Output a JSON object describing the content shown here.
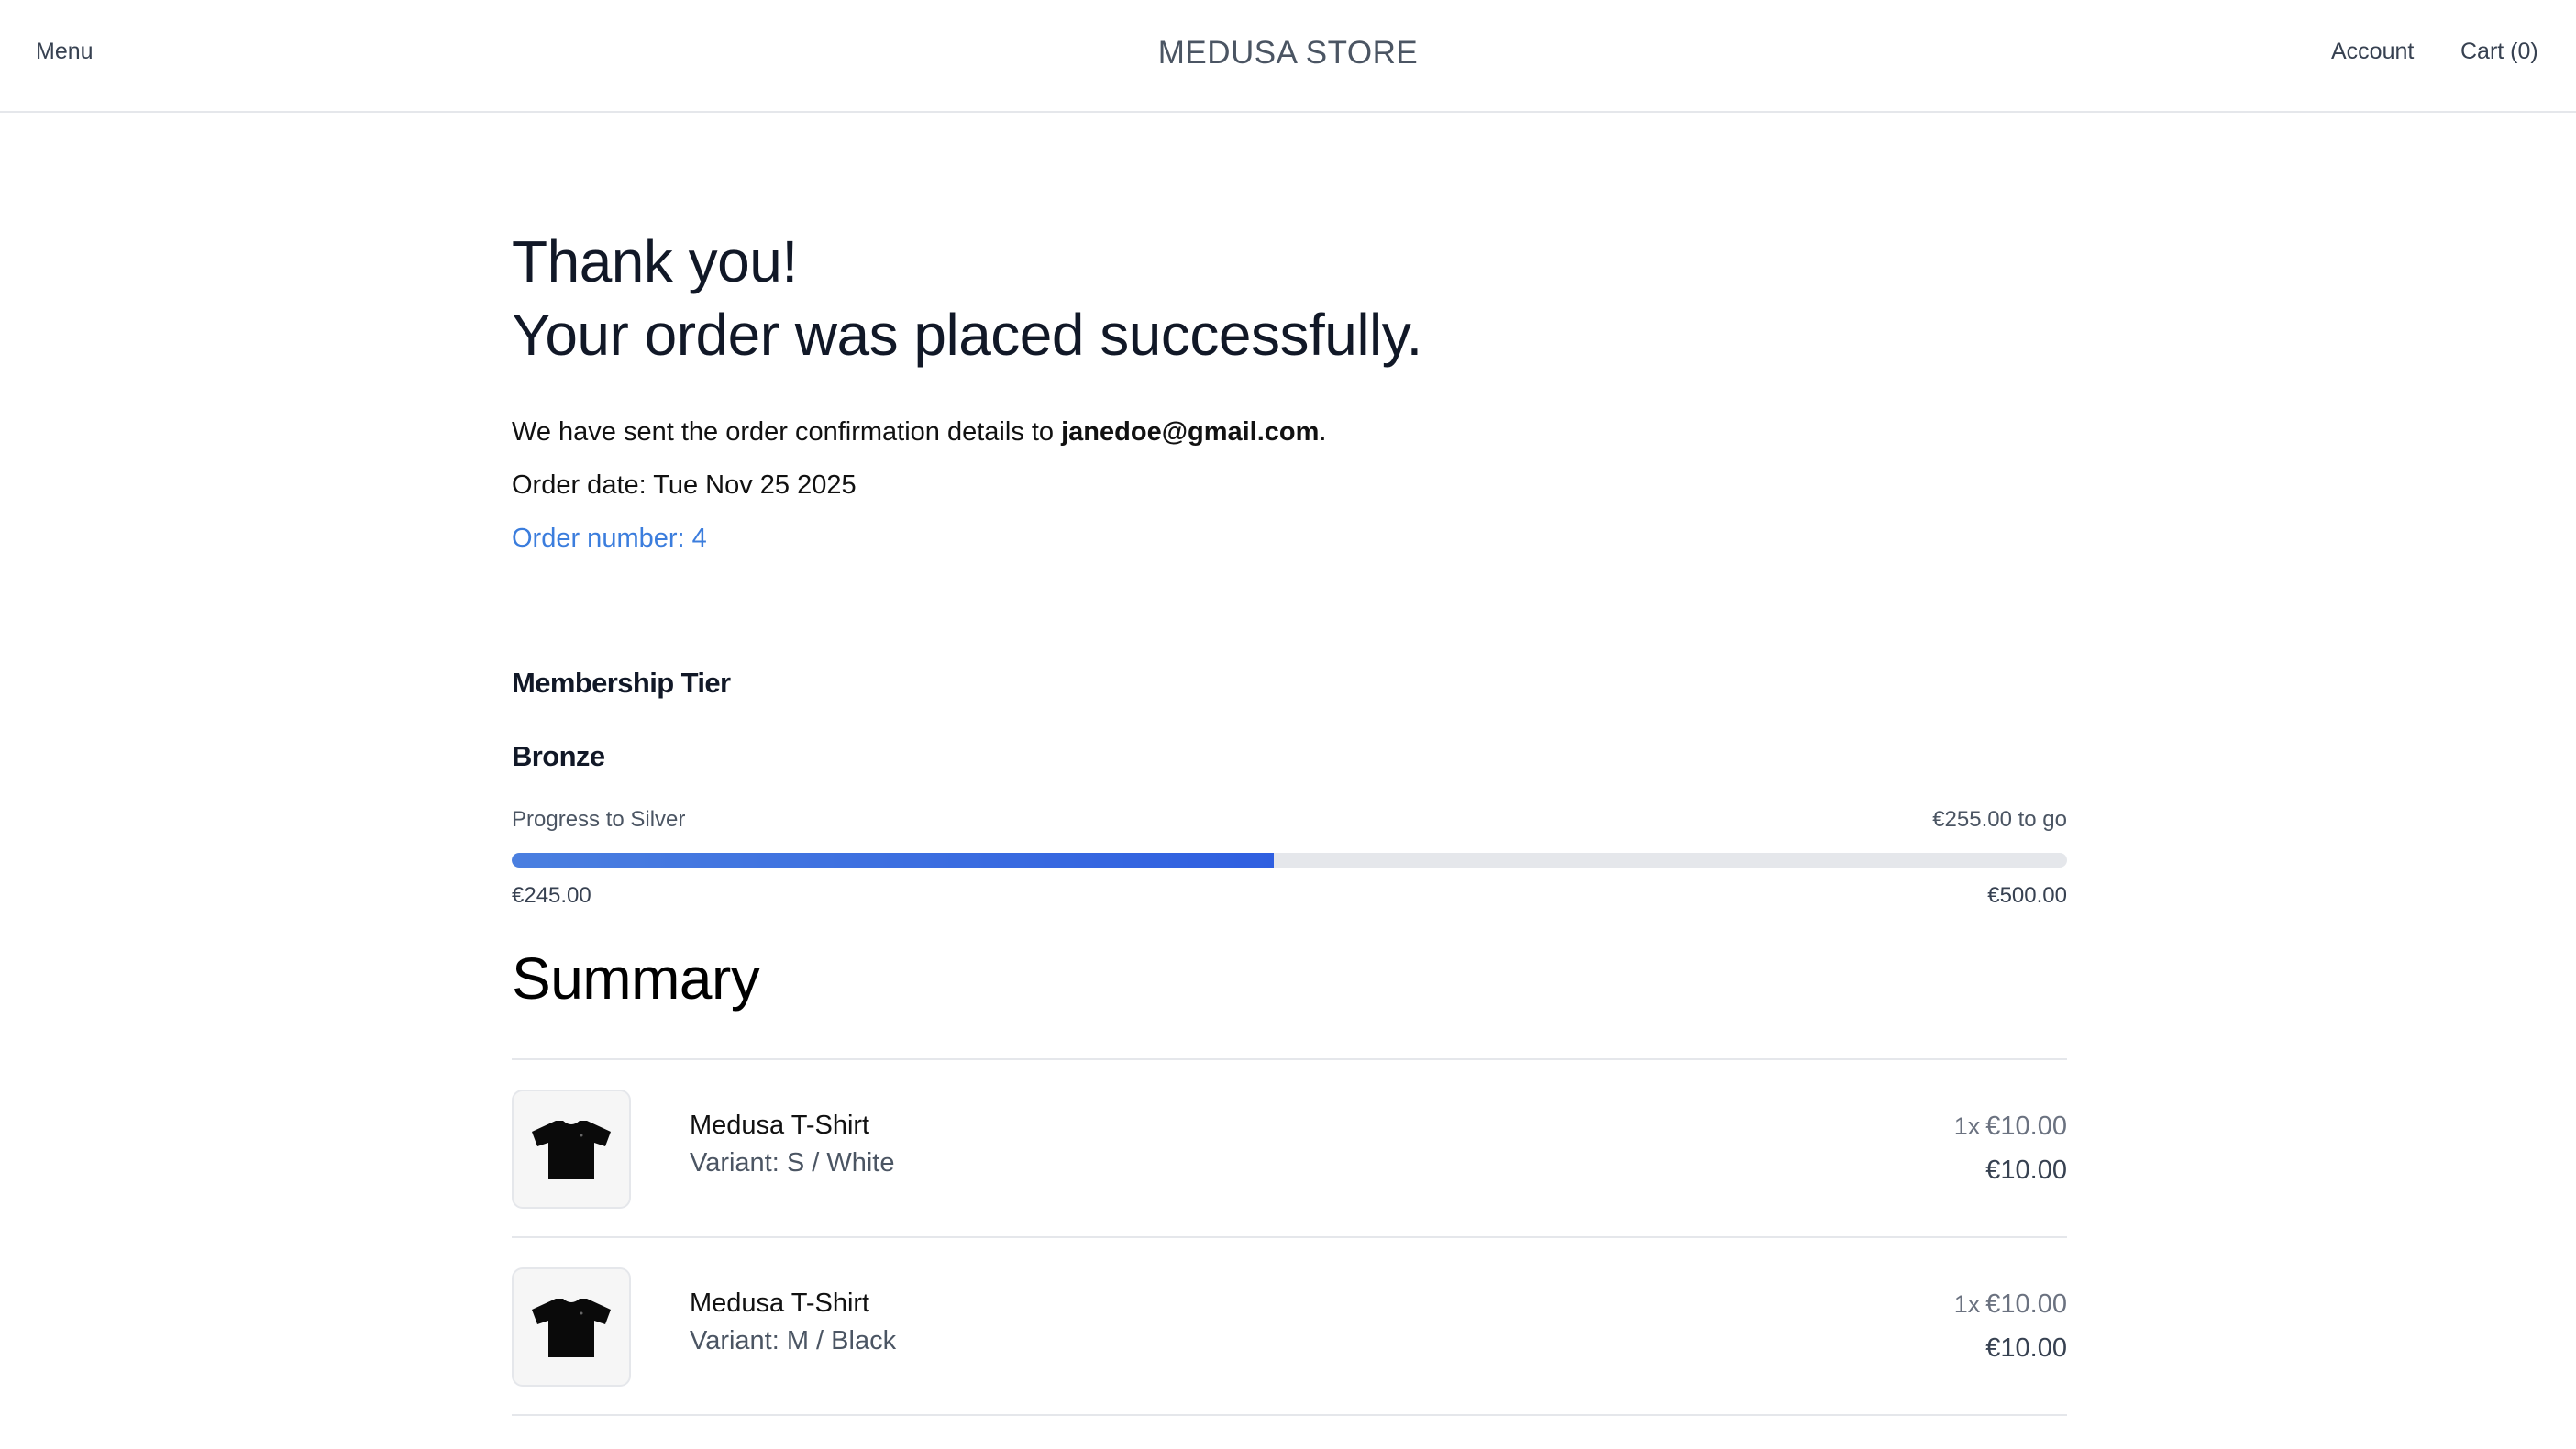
{
  "nav": {
    "menu_label": "Menu",
    "brand": "MEDUSA STORE",
    "account_label": "Account",
    "cart_label": "Cart (0)"
  },
  "confirmation": {
    "heading_line1": "Thank you!",
    "heading_line2": "Your order was placed successfully.",
    "sent_prefix": "We have sent the order confirmation details to ",
    "email": "janedoe@gmail.com",
    "sent_suffix": ".",
    "order_date": "Order date: Tue Nov 25 2025",
    "order_number": "Order number: 4"
  },
  "membership": {
    "title": "Membership Tier",
    "tier": "Bronze",
    "progress_label": "Progress to Silver",
    "to_go": "€255.00 to go",
    "progress_fraction": 0.49,
    "current_amount": "€245.00",
    "target_amount": "€500.00",
    "bar_color": "#3b6fe0"
  },
  "summary": {
    "title": "Summary",
    "items": [
      {
        "title": "Medusa T-Shirt",
        "variant": "Variant: S / White",
        "quantity": "1x",
        "unit_price": "€10.00",
        "total": "€10.00",
        "icon": "tshirt-icon"
      },
      {
        "title": "Medusa T-Shirt",
        "variant": "Variant: M / Black",
        "quantity": "1x",
        "unit_price": "€10.00",
        "total": "€10.00",
        "icon": "tshirt-icon"
      }
    ]
  }
}
